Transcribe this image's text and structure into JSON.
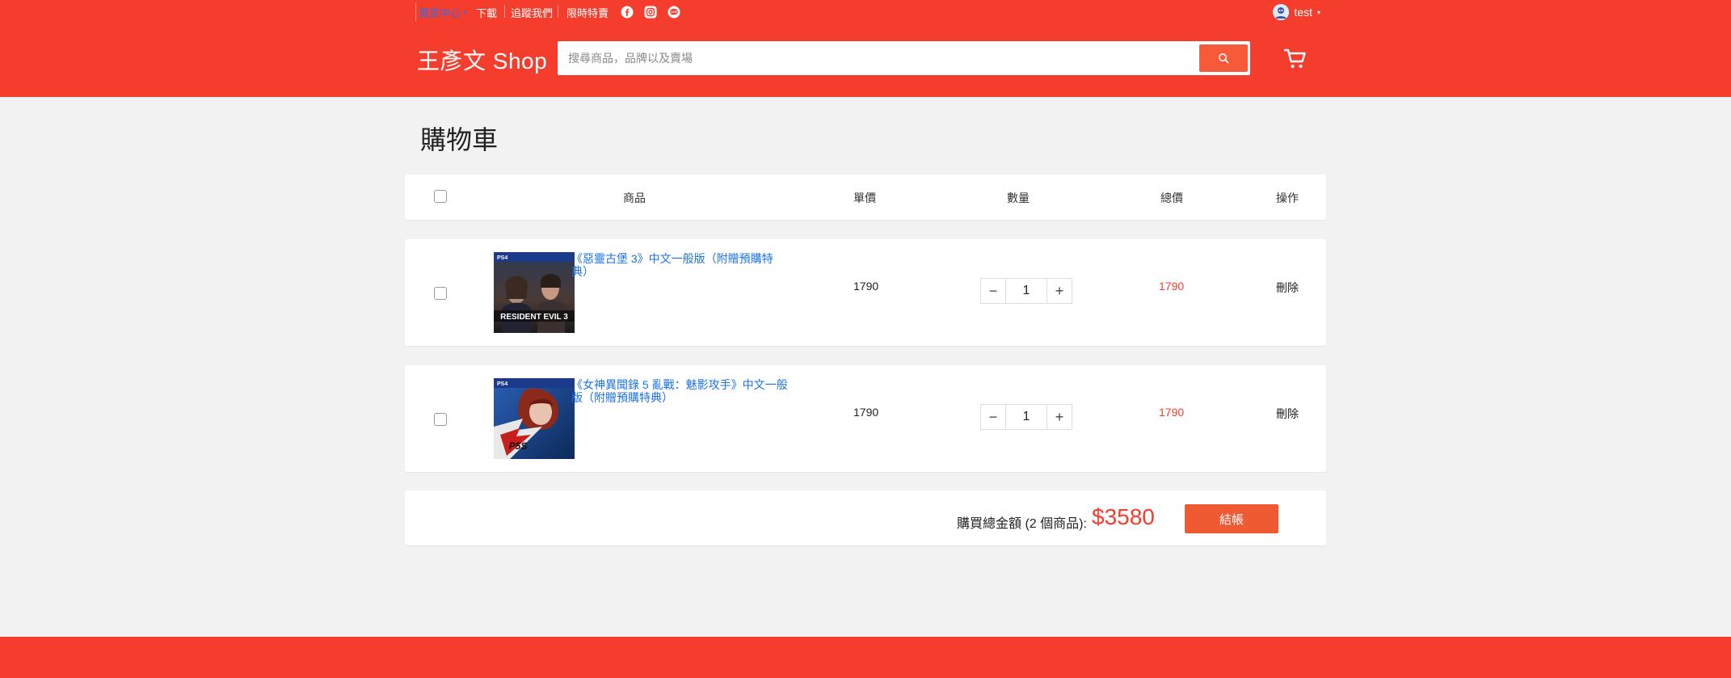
{
  "topbar": {
    "seller_center": "賣家中心",
    "download": "下載",
    "follow_us": "追蹤我們",
    "flash_sale": "限時特賣",
    "social_icons": [
      "facebook-icon",
      "instagram-icon",
      "line-icon"
    ],
    "username": "test"
  },
  "header": {
    "logo": "王彥文 Shop",
    "search_placeholder": "搜尋商品，品牌以及賣場"
  },
  "page": {
    "title": "購物車"
  },
  "table": {
    "headers": {
      "product": "商品",
      "unit_price": "單價",
      "quantity": "數量",
      "total": "總價",
      "action": "操作"
    }
  },
  "items": [
    {
      "name": "《惡靈古堡 3》中文一般版（附贈預購特典）",
      "platform": "PS4",
      "cover_text": "RESIDENT EVIL 3",
      "price": "1790",
      "quantity": "1",
      "total": "1790",
      "delete_label": "刪除"
    },
    {
      "name": "《女神異聞錄 5 亂戰：魅影攻手》中文一般版（附贈預購特典）",
      "platform": "PS4",
      "cover_text": "P5S",
      "price": "1790",
      "quantity": "1",
      "total": "1790",
      "delete_label": "刪除"
    }
  ],
  "summary": {
    "label": "購買總金額 (2 個商品):",
    "amount": "$3580",
    "checkout_label": "結帳"
  },
  "colors": {
    "brand": "#f53d2d",
    "link": "#1a73e8",
    "background": "#f2f2f2"
  }
}
